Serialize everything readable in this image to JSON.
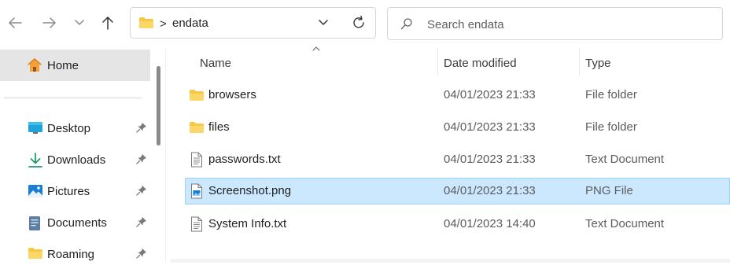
{
  "nav": {
    "back_icon": "arrow-left-icon",
    "forward_icon": "arrow-right-icon",
    "recent_icon": "chevron-down-icon",
    "up_icon": "arrow-up-icon"
  },
  "address": {
    "folder_icon": "folder-icon",
    "separator": ">",
    "crumb": "endata"
  },
  "search": {
    "placeholder": "Search endata",
    "value": ""
  },
  "sidebar": {
    "home": {
      "label": "Home",
      "icon": "home-icon"
    },
    "items": [
      {
        "label": "Desktop",
        "icon": "desktop-icon",
        "pinned": true
      },
      {
        "label": "Downloads",
        "icon": "download-icon",
        "pinned": true
      },
      {
        "label": "Pictures",
        "icon": "pictures-icon",
        "pinned": true
      },
      {
        "label": "Documents",
        "icon": "documents-icon",
        "pinned": true
      },
      {
        "label": "Roaming",
        "icon": "folder-icon",
        "pinned": true
      }
    ]
  },
  "columns": {
    "name": "Name",
    "date": "Date modified",
    "type": "Type"
  },
  "files": [
    {
      "name": "browsers",
      "date": "04/01/2023 21:33",
      "type": "File folder",
      "icon": "folder-icon",
      "selected": false
    },
    {
      "name": "files",
      "date": "04/01/2023 21:33",
      "type": "File folder",
      "icon": "folder-icon",
      "selected": false
    },
    {
      "name": "passwords.txt",
      "date": "04/01/2023 21:33",
      "type": "Text Document",
      "icon": "text-file-icon",
      "selected": false
    },
    {
      "name": "Screenshot.png",
      "date": "04/01/2023 21:33",
      "type": "PNG File",
      "icon": "image-file-icon",
      "selected": true
    },
    {
      "name": "System Info.txt",
      "date": "04/01/2023 14:40",
      "type": "Text Document",
      "icon": "text-file-icon",
      "selected": false
    }
  ],
  "colors": {
    "selection_bg": "#cce8ff",
    "selection_border": "#99d1ff",
    "folder_yellow": "#f8c845",
    "accent_blue": "#1a7fd4"
  }
}
